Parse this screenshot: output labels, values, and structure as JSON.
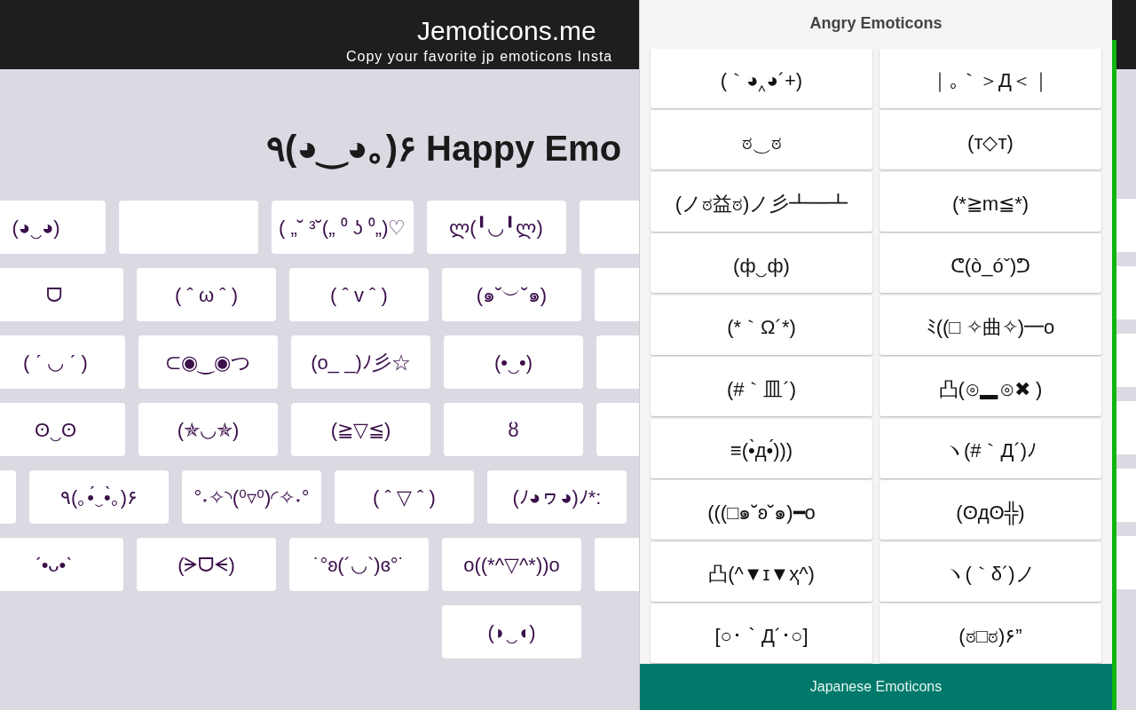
{
  "header": {
    "title": "Jemoticons.me",
    "subtitle": "Copy your favorite jp emoticons Insta"
  },
  "heading": "٩(◕‿◕｡)۶ Happy Emo",
  "happy_rows": [
    {
      "items": [
        {
          "kind": "emoticon",
          "text": "(◕‿◕)"
        },
        {
          "kind": "blank"
        },
        {
          "kind": "emoticon",
          "text": "( „˘ ³˘(„ ⁰ ʖ ⁰„)♡"
        },
        {
          "kind": "emoticon",
          "text": "ლ(╹◡╹ლ)"
        },
        {
          "kind": "blank"
        }
      ]
    },
    {
      "items": [
        {
          "kind": "emoticon",
          "text": "ᗜ"
        },
        {
          "kind": "emoticon",
          "text": "( ˆ ω ˆ )"
        },
        {
          "kind": "emoticon",
          "text": "( ˆ v ˆ )"
        },
        {
          "kind": "emoticon",
          "text": "(๑˘︶˘๑)"
        },
        {
          "kind": "blank"
        }
      ]
    },
    {
      "items": [
        {
          "kind": "emoticon",
          "text": "( ˊ ◡ ˊ )"
        },
        {
          "kind": "emoticon",
          "text": "⊂◉‿◉つ"
        },
        {
          "kind": "emoticon",
          "text": "(o_ _)ﾉ彡☆"
        },
        {
          "kind": "emoticon",
          "text": "(•‿•)"
        },
        {
          "kind": "blank"
        }
      ]
    },
    {
      "items": [
        {
          "kind": "emoticon",
          "text": "ʘ‿ʘ"
        },
        {
          "kind": "emoticon",
          "text": "(✯◡✯)"
        },
        {
          "kind": "emoticon",
          "text": "(≧▽≦)"
        },
        {
          "kind": "emoticon",
          "text": "ȣ"
        },
        {
          "kind": "blank"
        }
      ]
    },
    {
      "items": [
        {
          "kind": "blank"
        },
        {
          "kind": "emoticon",
          "text": "٩(｡•́‿•̀｡)۶"
        },
        {
          "kind": "emoticon",
          "text": "°˖✧◝(⁰▿⁰)◜✧˖°"
        },
        {
          "kind": "emoticon",
          "text": "( ˆ ▽ ˆ )"
        },
        {
          "kind": "emoticon",
          "text": "(ﾉ◕ヮ◕)ﾉ*:"
        }
      ]
    },
    {
      "items": [
        {
          "kind": "emoticon",
          "text": "ˊ•ᴗ•ˋ"
        },
        {
          "kind": "emoticon",
          "text": "(ᗒᗜᗕ)"
        },
        {
          "kind": "emoticon",
          "text": "˙°ʚ(´◡`)ɞ°˙"
        },
        {
          "kind": "emoticon",
          "text": "o((*^▽^*))o"
        },
        {
          "kind": "blank"
        }
      ]
    },
    {
      "items": [
        {
          "kind": "emoticon",
          "text": "(◗‿◖)"
        }
      ]
    }
  ],
  "popup": {
    "title": "Angry Emoticons",
    "emoticons": [
      "(｀◕‸◕´+)",
      "｜｡｀＞Д＜｜",
      "ಠ‿ಠ",
      "(ᴛ◇ᴛ)",
      "(ノಠ益ಠ)ノ彡┻━┻",
      "(*≧m≦*)",
      "(ф‿ф)",
      "ᕦ(ò_óˇ)ᕤ",
      "(*｀Ω´*)",
      "ﾐ((□ ✧曲✧)━o",
      "(#｀皿´)",
      "凸(⊙▂⊙✖ )",
      "≡(•̀д•́)))",
      "ヽ(#｀Д´)ﾉ",
      "(((□๑˘ʚ˘๑)━o",
      "(ʘдʘ╬)",
      "凸(^▼ɪ▼ҳ^)",
      "ヽ(｀δ´)ノ",
      "[○･｀Д´･○]",
      "(ಠ□ಠ)۶”"
    ],
    "footer": "Japanese Emoticons"
  }
}
